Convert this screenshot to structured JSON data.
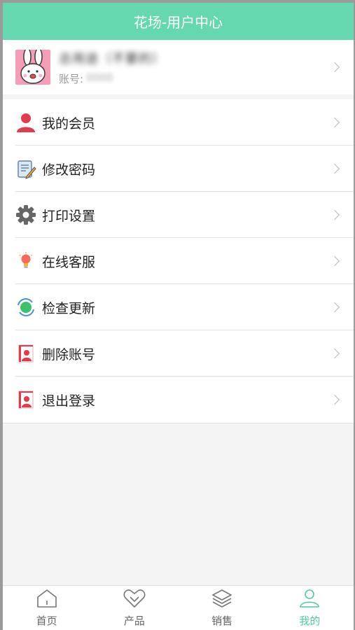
{
  "header": {
    "title": "花场-用户中心"
  },
  "profile": {
    "name": "总用途（不要的）",
    "account_label": "账号:",
    "account_value": "0000"
  },
  "menu": {
    "items": [
      {
        "label": "我的会员",
        "icon": "user-icon"
      },
      {
        "label": "修改密码",
        "icon": "edit-document-icon"
      },
      {
        "label": "打印设置",
        "icon": "gear-icon"
      },
      {
        "label": "在线客服",
        "icon": "lightbulb-icon"
      },
      {
        "label": "检查更新",
        "icon": "refresh-icon"
      },
      {
        "label": "删除账号",
        "icon": "delete-account-icon"
      },
      {
        "label": "退出登录",
        "icon": "logout-icon"
      }
    ]
  },
  "tabbar": {
    "tabs": [
      {
        "label": "首页",
        "icon": "home-icon"
      },
      {
        "label": "产品",
        "icon": "heart-icon"
      },
      {
        "label": "销售",
        "icon": "layers-icon"
      },
      {
        "label": "我的",
        "icon": "person-icon",
        "active": true
      }
    ]
  },
  "colors": {
    "accent": "#66d8b0",
    "active_tab": "#4fcca0"
  }
}
